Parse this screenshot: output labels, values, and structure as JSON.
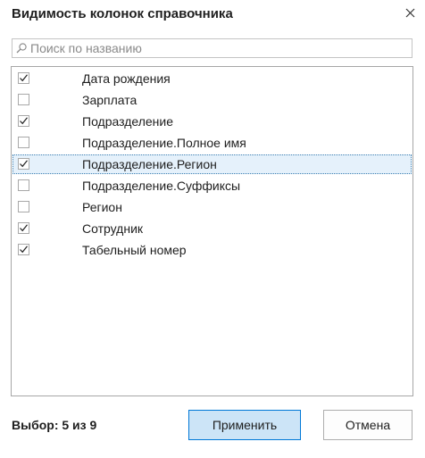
{
  "dialog": {
    "title": "Видимость колонок справочника",
    "close_icon": "close-icon"
  },
  "search": {
    "placeholder": "Поиск по названию",
    "value": "",
    "icon": "search-icon"
  },
  "columns": [
    {
      "label": "Дата рождения",
      "checked": true,
      "selected": false
    },
    {
      "label": "Зарплата",
      "checked": false,
      "selected": false
    },
    {
      "label": "Подразделение",
      "checked": true,
      "selected": false
    },
    {
      "label": "Подразделение.Полное имя",
      "checked": false,
      "selected": false
    },
    {
      "label": "Подразделение.Регион",
      "checked": true,
      "selected": true
    },
    {
      "label": "Подразделение.Суффиксы",
      "checked": false,
      "selected": false
    },
    {
      "label": "Регион",
      "checked": false,
      "selected": false
    },
    {
      "label": "Сотрудник",
      "checked": true,
      "selected": false
    },
    {
      "label": "Табельный номер",
      "checked": true,
      "selected": false
    }
  ],
  "footer": {
    "status": "Выбор: 5 из 9",
    "apply_label": "Применить",
    "cancel_label": "Отмена"
  },
  "colors": {
    "accent_border": "#0078d7",
    "apply_bg": "#cce4f7",
    "selected_row_bg": "#e5f1fb"
  }
}
